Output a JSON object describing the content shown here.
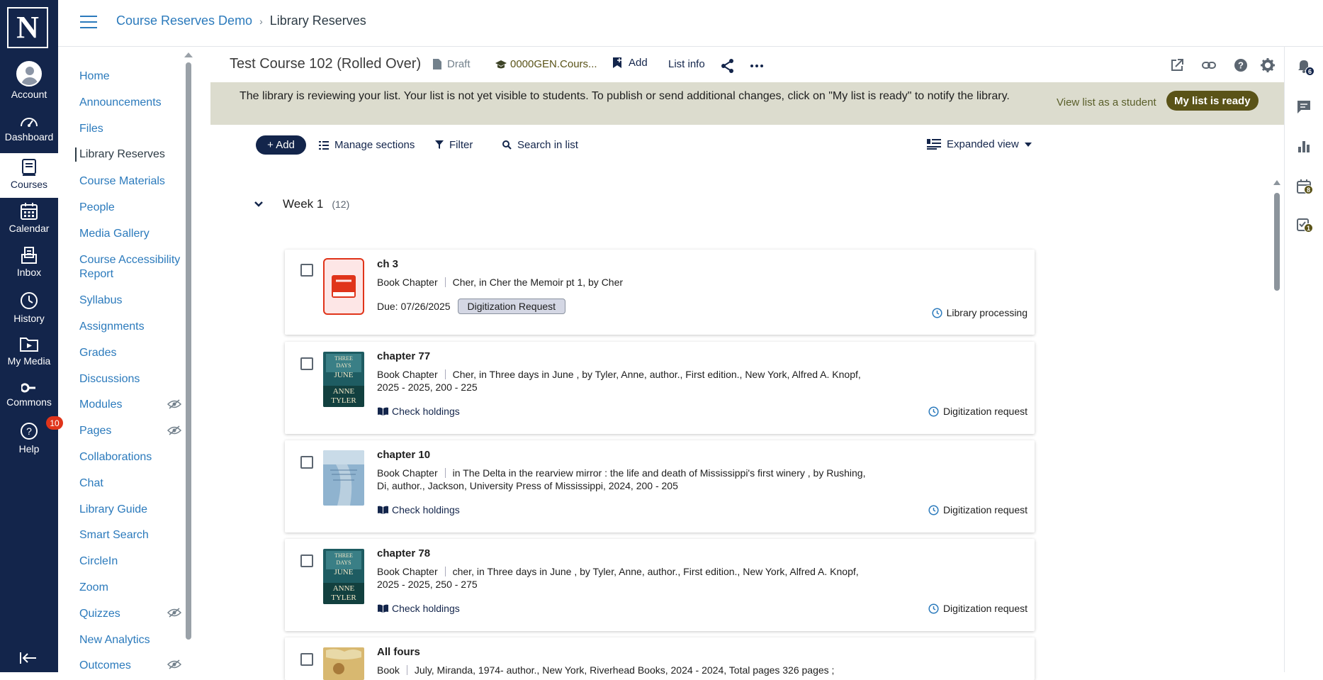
{
  "global_nav": {
    "items": [
      {
        "label": "Account"
      },
      {
        "label": "Dashboard"
      },
      {
        "label": "Courses"
      },
      {
        "label": "Calendar"
      },
      {
        "label": "Inbox"
      },
      {
        "label": "History"
      },
      {
        "label": "My Media"
      },
      {
        "label": "Commons"
      },
      {
        "label": "Help",
        "badge": "10"
      }
    ],
    "logo_letter": "N",
    "brand_color": "#13254b"
  },
  "breadcrumb": {
    "course": "Course Reserves Demo",
    "separator": "›",
    "page": "Library Reserves"
  },
  "course_nav": {
    "items": [
      {
        "label": "Home"
      },
      {
        "label": "Announcements"
      },
      {
        "label": "Files"
      },
      {
        "label": "Library Reserves"
      },
      {
        "label": "Course Materials"
      },
      {
        "label": "People"
      },
      {
        "label": "Media Gallery"
      },
      {
        "label": "Course Accessibility Report"
      },
      {
        "label": "Syllabus"
      },
      {
        "label": "Assignments"
      },
      {
        "label": "Grades"
      },
      {
        "label": "Discussions"
      },
      {
        "label": "Modules"
      },
      {
        "label": "Pages"
      },
      {
        "label": "Collaborations"
      },
      {
        "label": "Chat"
      },
      {
        "label": "Library Guide"
      },
      {
        "label": "Smart Search"
      },
      {
        "label": "CircleIn"
      },
      {
        "label": "Zoom"
      },
      {
        "label": "Quizzes"
      },
      {
        "label": "New Analytics"
      },
      {
        "label": "Outcomes"
      }
    ]
  },
  "list_header": {
    "title": "Test Course 102 (Rolled Over)",
    "status": "Draft",
    "course_code": "0000GEN.Cours...",
    "add_label": "Add",
    "info_label": "List info"
  },
  "banner": {
    "message": "The library is reviewing your list. Your list is not yet visible to students. To publish or send additional changes, click on \"My list is ready\" to notify the library.",
    "view_student": "View list as a student",
    "ready": "My list is ready"
  },
  "toolbar": {
    "add": "+ Add",
    "manage": "Manage sections",
    "filter": "Filter",
    "search": "Search in list",
    "view": "Expanded view"
  },
  "section": {
    "name": "Week 1",
    "count": "(12)"
  },
  "items": [
    {
      "title": "ch 3",
      "type": "Book Chapter",
      "desc": "Cher, in Cher the Memoir pt 1, by Cher",
      "due": "Due: 07/26/2025",
      "tag": "Digitization Request",
      "status": "Library processing"
    },
    {
      "title": "chapter 77",
      "type": "Book Chapter",
      "desc": "Cher, in Three days in June , by Tyler, Anne, author., First edition., New York, Alfred A. Knopf, 2025 - 2025, 200 - 225",
      "action": "Check holdings",
      "status": "Digitization request",
      "cover_lines": [
        "THREE",
        "DAYS",
        "JUNE",
        "ANNE",
        "TYLER"
      ]
    },
    {
      "title": "chapter 10",
      "type": "Book Chapter",
      "desc": "in The Delta in the rearview mirror : the life and death of Mississippi's first winery , by Rushing, Di, author., Jackson, University Press of Mississippi, 2024, 200 - 205",
      "action": "Check holdings",
      "status": "Digitization request"
    },
    {
      "title": "chapter 78",
      "type": "Book Chapter",
      "desc": "cher, in Three days in June , by Tyler, Anne, author., First edition., New York, Alfred A. Knopf, 2025 - 2025, 250 - 275",
      "action": "Check holdings",
      "status": "Digitization request",
      "cover_lines": [
        "THREE",
        "DAYS",
        "JUNE",
        "ANNE",
        "TYLER"
      ]
    },
    {
      "title": "All fours",
      "type": "Book",
      "desc": "July, Miranda, 1974- author., New York, Riverhead Books, 2024 - 2024, Total pages 326 pages ;"
    }
  ],
  "right_rail": {
    "notifications_badge": "6",
    "calendar_badge": "8",
    "tasks_badge": "1"
  }
}
